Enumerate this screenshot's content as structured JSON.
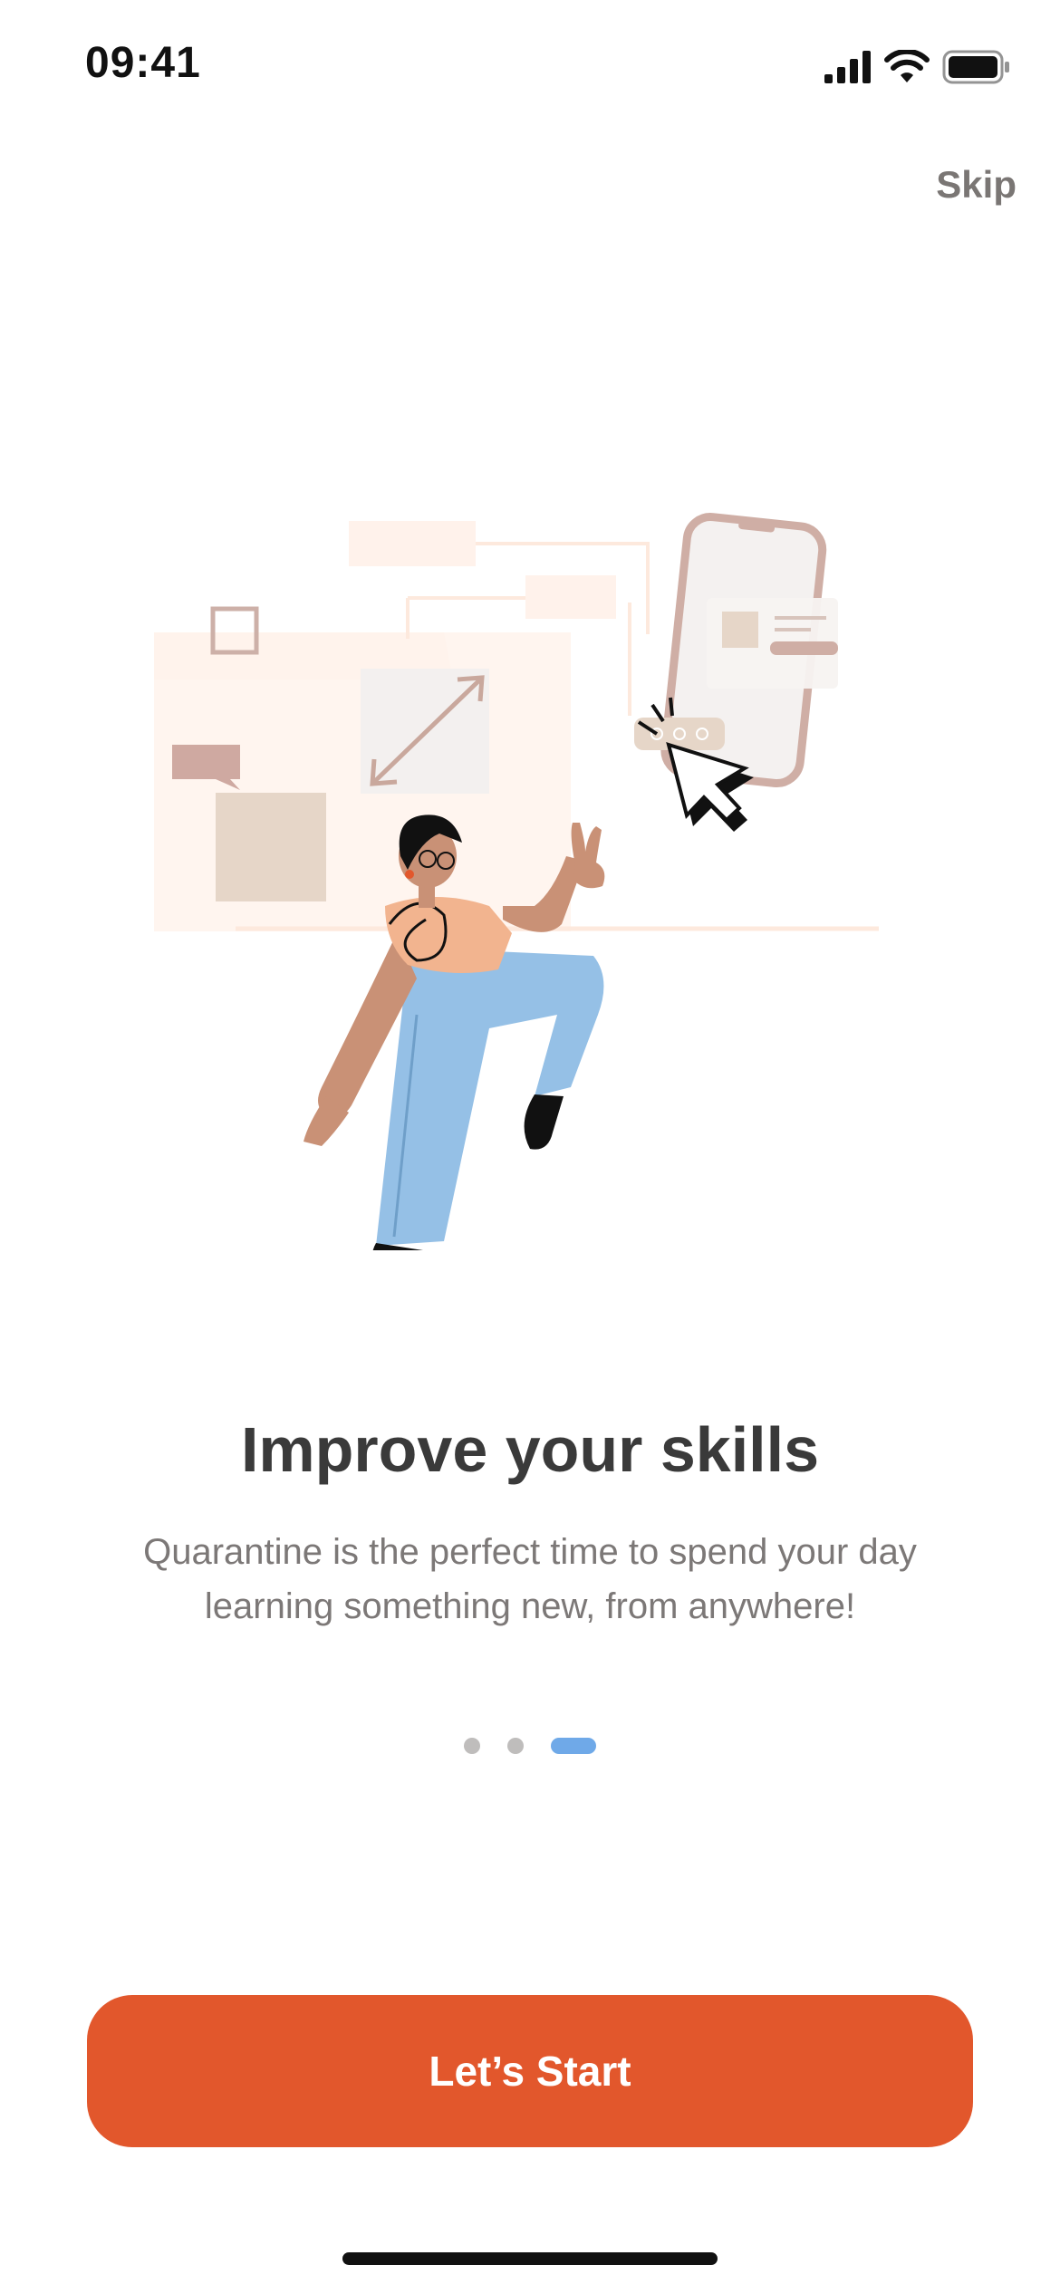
{
  "status_bar": {
    "time": "09:41",
    "icons": [
      "cellular-signal-icon",
      "wifi-icon",
      "battery-icon"
    ]
  },
  "header": {
    "skip_label": "Skip"
  },
  "onboarding": {
    "illustration": "person-waving-with-phone-illustration",
    "title": "Improve your skills",
    "description": "Quarantine is the perfect time to spend your day learning something new, from anywhere!",
    "pagination": {
      "total": 3,
      "current": 3
    }
  },
  "cta": {
    "label": "Let’s Start"
  },
  "colors": {
    "accent": "#e2572c",
    "active_dot": "#6fa9e8",
    "inactive_dot": "#bfbdbc",
    "title": "#3a3a3a",
    "body_text": "#7c7877"
  }
}
